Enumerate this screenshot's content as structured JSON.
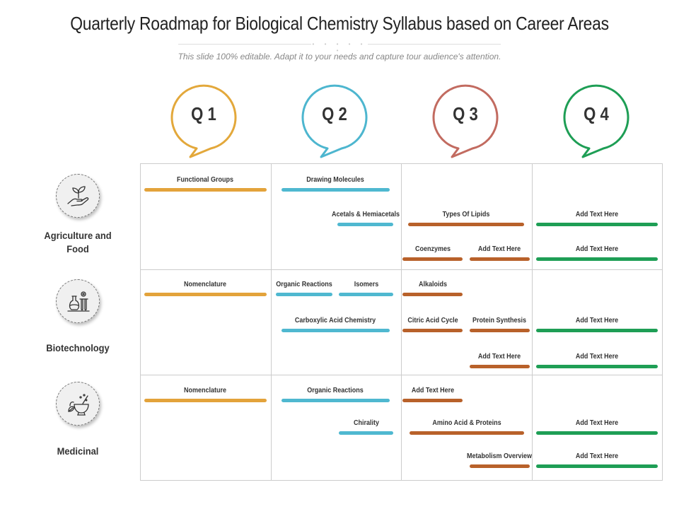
{
  "header": {
    "title": "Quarterly Roadmap for Biological Chemistry Syllabus based on Career Areas",
    "dots": "• • • • • •",
    "subtitle": "This slide 100% editable. Adapt it to your needs and capture tour audience's attention."
  },
  "quarters": [
    {
      "label": "Q 1",
      "color": "#E3A83B",
      "bar_color": "#E3A33B"
    },
    {
      "label": "Q 2",
      "color": "#4DB6CF",
      "bar_color": "#4FB8D0"
    },
    {
      "label": "Q 3",
      "color": "#C26B60",
      "bar_color": "#B8612A"
    },
    {
      "label": "Q 4",
      "color": "#1E9E55",
      "bar_color": "#1E9E55"
    }
  ],
  "areas": [
    {
      "label": "Agriculture  and Food",
      "icon": "plant-in-hand-icon"
    },
    {
      "label": "Biotechnology",
      "icon": "lab-flask-gear-icon"
    },
    {
      "label": "Medicinal",
      "icon": "mortar-pestle-icon"
    }
  ],
  "tasks": [
    {
      "area": 0,
      "lane": 0,
      "quarter": 0,
      "start": 0.03,
      "end": 0.97,
      "label": "Functional Groups"
    },
    {
      "area": 0,
      "lane": 0,
      "quarter": 1,
      "start": 1.08,
      "end": 1.91,
      "label": "Drawing Molecules"
    },
    {
      "area": 0,
      "lane": 1,
      "quarter": 1,
      "start": 1.51,
      "end": 1.94,
      "label": "Acetals & Hemiacetals"
    },
    {
      "area": 0,
      "lane": 1,
      "quarter": 2,
      "start": 2.05,
      "end": 2.94,
      "label": "Types Of Lipids"
    },
    {
      "area": 0,
      "lane": 2,
      "quarter": 2,
      "start": 2.01,
      "end": 2.47,
      "label": "Coenzymes"
    },
    {
      "area": 0,
      "lane": 2,
      "quarter": 2,
      "start": 2.52,
      "end": 2.98,
      "label": "Add Text Here"
    },
    {
      "area": 0,
      "lane": 1,
      "quarter": 3,
      "start": 3.03,
      "end": 3.96,
      "label": "Add Text Here"
    },
    {
      "area": 0,
      "lane": 2,
      "quarter": 3,
      "start": 3.03,
      "end": 3.96,
      "label": "Add Text Here"
    },
    {
      "area": 1,
      "lane": 0,
      "quarter": 0,
      "start": 0.03,
      "end": 0.97,
      "label": "Nomenclature"
    },
    {
      "area": 1,
      "lane": 0,
      "quarter": 1,
      "start": 1.04,
      "end": 1.47,
      "label": "Organic Reactions"
    },
    {
      "area": 1,
      "lane": 0,
      "quarter": 1,
      "start": 1.52,
      "end": 1.94,
      "label": "Isomers"
    },
    {
      "area": 1,
      "lane": 1,
      "quarter": 1,
      "start": 1.08,
      "end": 1.91,
      "label": "Carboxylic Acid Chemistry"
    },
    {
      "area": 1,
      "lane": 0,
      "quarter": 2,
      "start": 2.01,
      "end": 2.47,
      "label": "Alkaloids"
    },
    {
      "area": 1,
      "lane": 1,
      "quarter": 2,
      "start": 2.01,
      "end": 2.47,
      "label": "Citric Acid Cycle"
    },
    {
      "area": 1,
      "lane": 1,
      "quarter": 2,
      "start": 2.52,
      "end": 2.98,
      "label": "Protein Synthesis"
    },
    {
      "area": 1,
      "lane": 2,
      "quarter": 2,
      "start": 2.52,
      "end": 2.98,
      "label": "Add Text Here"
    },
    {
      "area": 1,
      "lane": 1,
      "quarter": 3,
      "start": 3.03,
      "end": 3.96,
      "label": "Add Text Here"
    },
    {
      "area": 1,
      "lane": 2,
      "quarter": 3,
      "start": 3.03,
      "end": 3.96,
      "label": "Add Text Here"
    },
    {
      "area": 2,
      "lane": 0,
      "quarter": 0,
      "start": 0.03,
      "end": 0.97,
      "label": "Nomenclature"
    },
    {
      "area": 2,
      "lane": 0,
      "quarter": 1,
      "start": 1.08,
      "end": 1.91,
      "label": "Organic Reactions"
    },
    {
      "area": 2,
      "lane": 1,
      "quarter": 1,
      "start": 1.52,
      "end": 1.94,
      "label": "Chirality"
    },
    {
      "area": 2,
      "lane": 0,
      "quarter": 2,
      "start": 2.01,
      "end": 2.47,
      "label": "Add Text Here"
    },
    {
      "area": 2,
      "lane": 1,
      "quarter": 2,
      "start": 2.06,
      "end": 2.94,
      "label": "Amino Acid & Proteins"
    },
    {
      "area": 2,
      "lane": 2,
      "quarter": 2,
      "start": 2.52,
      "end": 2.98,
      "label": "Metabolism Overview"
    },
    {
      "area": 2,
      "lane": 1,
      "quarter": 3,
      "start": 3.03,
      "end": 3.96,
      "label": "Add Text Here"
    },
    {
      "area": 2,
      "lane": 2,
      "quarter": 3,
      "start": 3.03,
      "end": 3.96,
      "label": "Add Text Here"
    }
  ]
}
